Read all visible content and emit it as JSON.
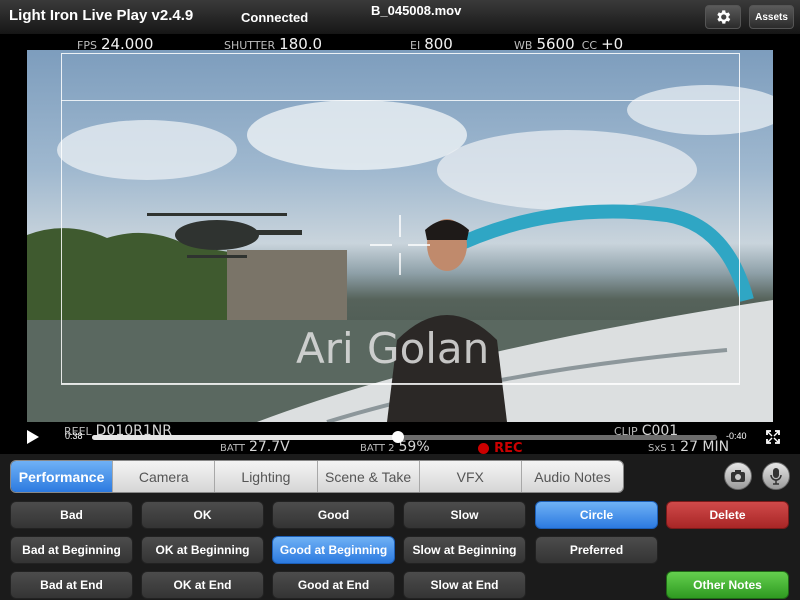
{
  "colors": {
    "accent_blue": "#2c7ae0",
    "delete_red": "#b32f2f",
    "notes_green": "#3aa52a",
    "scrub_fill": "#e6e6e6"
  },
  "header": {
    "title": "Light Iron Live Play v2.4.9",
    "status": "Connected",
    "filename": "B_045008.mov",
    "settings_icon": "gear-icon",
    "assets_label": "Assets"
  },
  "camera_meta": {
    "fps_label": "FPS",
    "fps_value": "24.000",
    "shutter_label": "SHUTTER",
    "shutter_value": "180.0",
    "ei_label": "EI",
    "ei_value": "800",
    "wb_label": "WB",
    "wb_value": "5600",
    "cc_label": "CC",
    "cc_value": "+0"
  },
  "video": {
    "watermark": "Ari Golan",
    "reel_label": "REEL",
    "reel_value": "D010R1NR",
    "batt1_label": "BATT",
    "batt1_value": "27.7V",
    "batt2_label": "BATT 2",
    "batt2_value": "59%",
    "rec_label": "REC",
    "sxs_label": "SxS 1",
    "sxs_value": "27 MIN",
    "clip_label": "CLIP",
    "clip_value": "C001"
  },
  "transport": {
    "play_icon": "play-icon",
    "elapsed": "0:38",
    "remaining": "-0:40",
    "progress": 0.49,
    "fullscreen_icon": "fullscreen-icon"
  },
  "tabs": [
    {
      "label": "Performance",
      "active": true
    },
    {
      "label": "Camera"
    },
    {
      "label": "Lighting"
    },
    {
      "label": "Scene & Take"
    },
    {
      "label": "VFX"
    },
    {
      "label": "Audio Notes"
    }
  ],
  "side_icons": {
    "camera_icon": "camera-icon",
    "mic_icon": "microphone-icon"
  },
  "notes": {
    "row1": [
      "Bad",
      "OK",
      "Good",
      "Slow",
      "Circle",
      "Delete"
    ],
    "row2": [
      "Bad at Beginning",
      "OK at Beginning",
      "Good at Beginning",
      "Slow at Beginning",
      "Preferred"
    ],
    "row3": [
      "Bad at End",
      "OK at End",
      "Good at End",
      "Slow at End"
    ],
    "other_notes": "Other Notes"
  }
}
